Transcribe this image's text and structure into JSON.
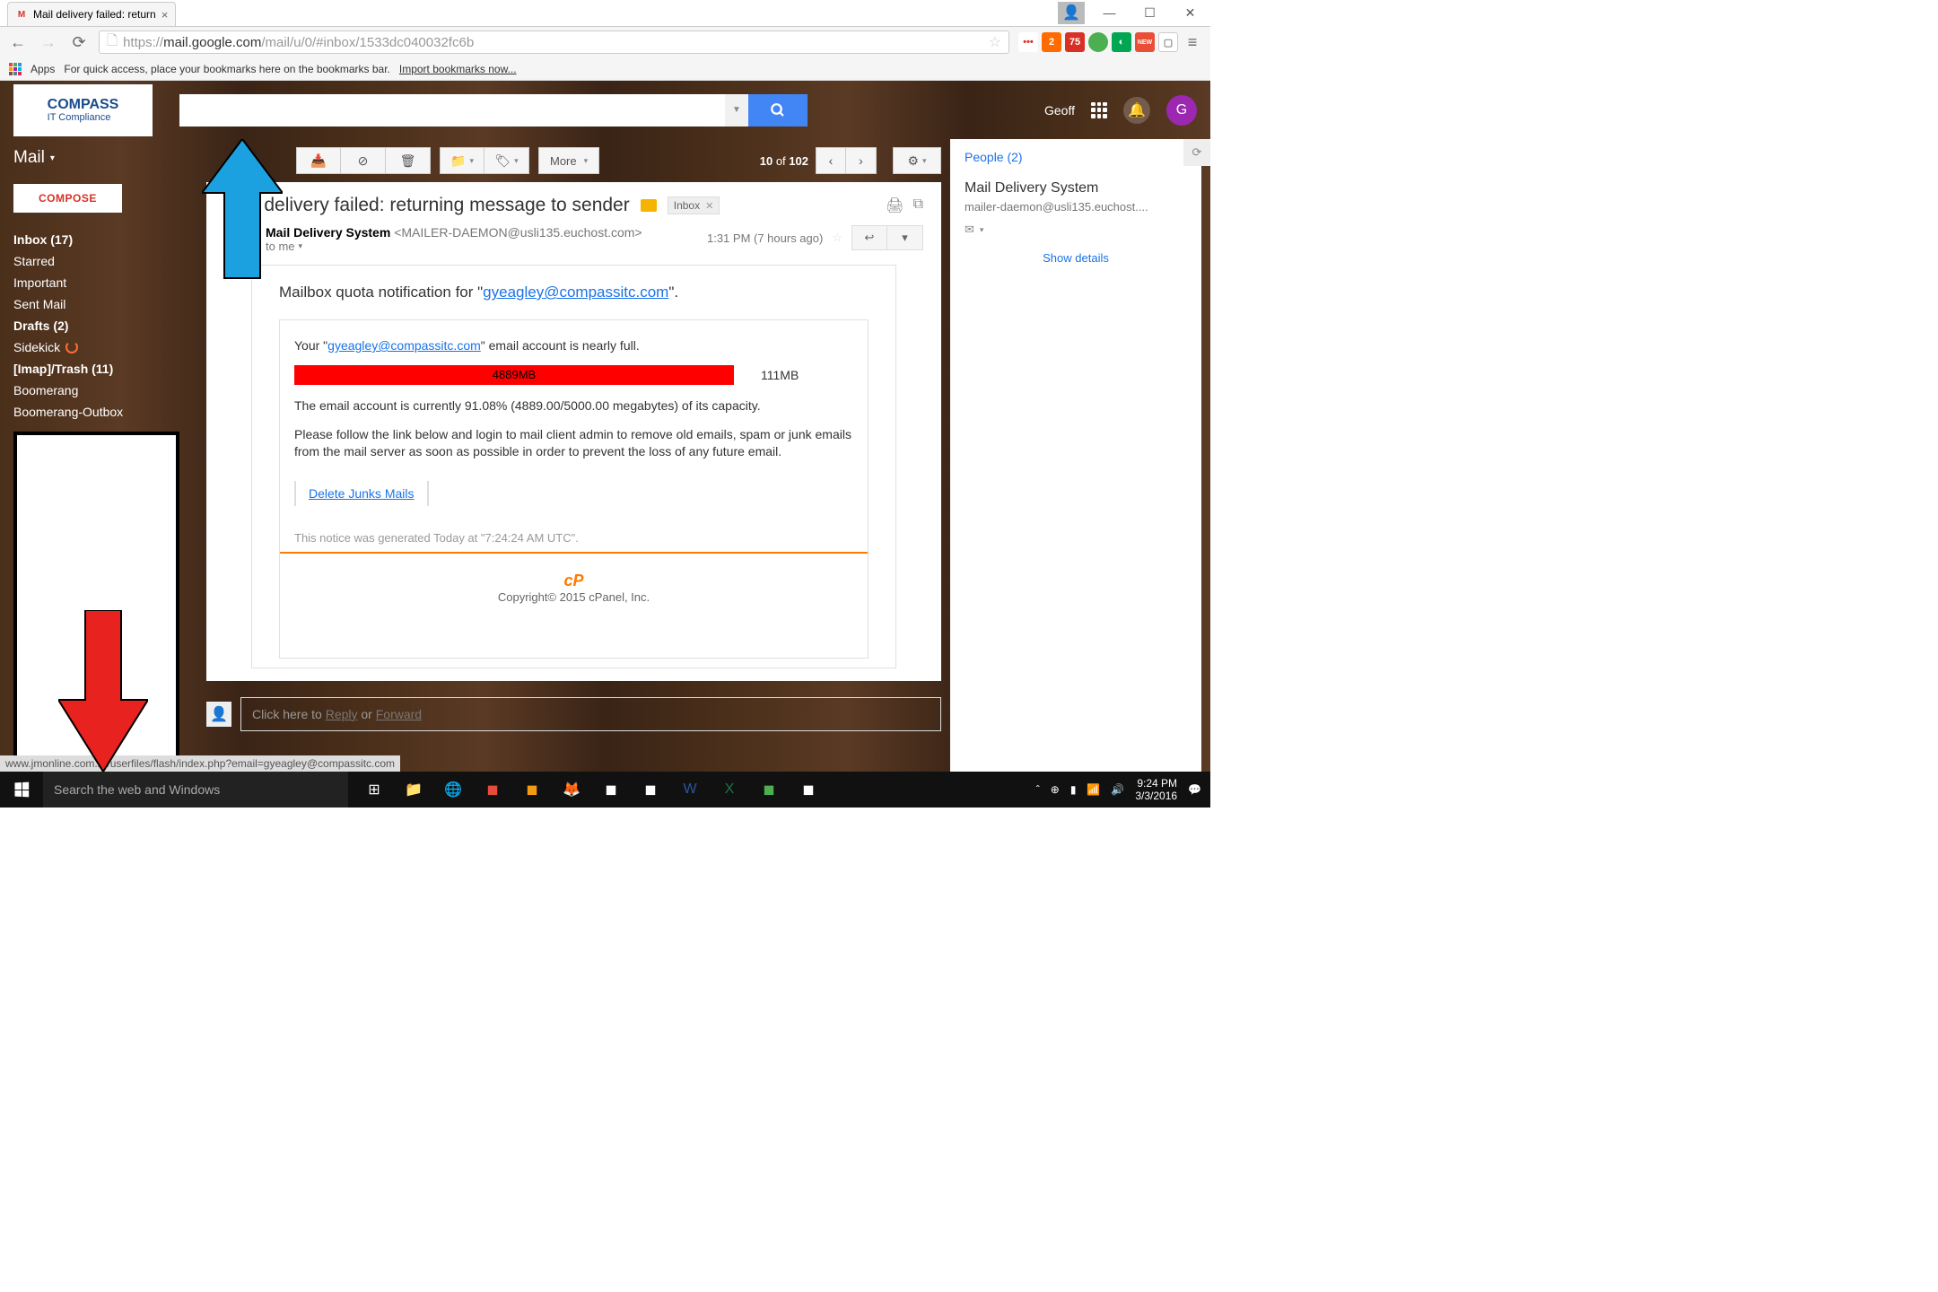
{
  "browser": {
    "tab_title": "Mail delivery failed: return",
    "url_proto": "https://",
    "url_domain": "mail.google.com",
    "url_path": "/mail/u/0/#inbox/1533dc040032fc6b",
    "apps_label": "Apps",
    "bookmarks_hint": "For quick access, place your bookmarks here on the bookmarks bar.",
    "import_link": "Import bookmarks now...",
    "status_url": "www.jmonline.com.br/userfiles/flash/index.php?email=gyeagley@compassitc.com"
  },
  "header": {
    "logo_text_1": "COMPASS",
    "logo_text_2": "IT Compliance",
    "user_name": "Geoff",
    "avatar_letter": "G"
  },
  "sidebar": {
    "mail_label": "Mail",
    "compose": "COMPOSE",
    "folders": [
      {
        "label": "Inbox (17)",
        "bold": true
      },
      {
        "label": "Starred",
        "bold": false
      },
      {
        "label": "Important",
        "bold": false
      },
      {
        "label": "Sent Mail",
        "bold": false
      },
      {
        "label": "Drafts (2)",
        "bold": true
      },
      {
        "label": "Sidekick",
        "bold": false,
        "icon": true
      },
      {
        "label": "[Imap]/Trash (11)",
        "bold": true
      },
      {
        "label": "Boomerang",
        "bold": false
      },
      {
        "label": "Boomerang-Outbox",
        "bold": false
      }
    ]
  },
  "toolbar": {
    "more": "More",
    "page_current": "10",
    "page_of": "of",
    "page_total": "102"
  },
  "email": {
    "subject": "Mail delivery failed: returning message to sender",
    "inbox_tag": "Inbox",
    "sender_name": "Mail Delivery System",
    "sender_email": "<MAILER-DAEMON@usli135.euchost.com>",
    "to_line": "to me",
    "time": "1:31 PM (7 hours ago)"
  },
  "body": {
    "quota_prefix": "Mailbox quota notification for \"",
    "quota_email": "gyeagley@compassitc.com",
    "quota_suffix": "\".",
    "your_prefix": "Your \"",
    "your_email": "gyeagley@compassitc.com",
    "your_suffix": "\" email account is nearly full.",
    "bar_used": "4889MB",
    "bar_remain": "111MB",
    "capacity": "The email account is currently 91.08% (4889.00/5000.00 megabytes) of its capacity.",
    "instruction": "Please follow the link below and login to mail client admin to remove old emails, spam or junk emails from the mail server as soon as possible in order to prevent the loss of any future email.",
    "delete_link": "Delete Junks Mails",
    "notice": "This notice was generated Today at \"7:24:24 AM UTC\".",
    "cpanel_logo": "cP",
    "copyright": "Copyright© 2015 cPanel, Inc."
  },
  "reply": {
    "prefix": "Click here to ",
    "reply": "Reply",
    "or": " or ",
    "forward": "Forward"
  },
  "rightpane": {
    "people": "People (2)",
    "name": "Mail Delivery System",
    "email": "mailer-daemon@usli135.euchost....",
    "details": "Show details"
  },
  "taskbar": {
    "search_placeholder": "Search the web and Windows",
    "time": "9:24 PM",
    "date": "3/3/2016"
  },
  "ext_badges": [
    "2",
    "75",
    "",
    "",
    "NEW",
    "",
    ""
  ]
}
